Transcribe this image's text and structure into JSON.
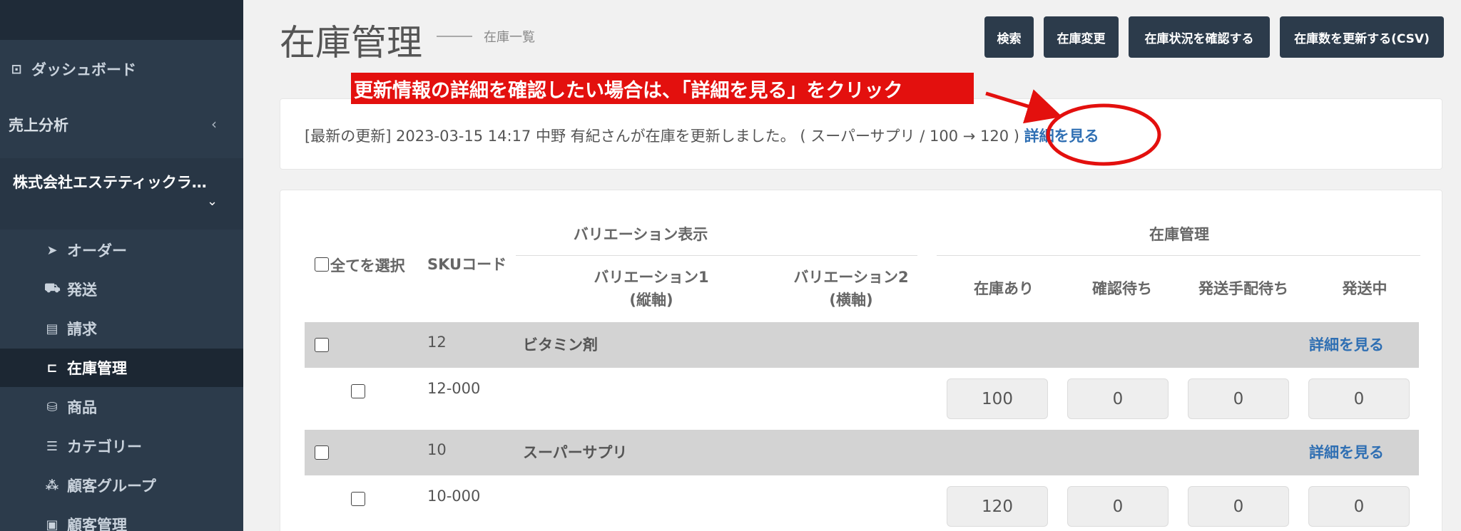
{
  "sidebar": {
    "dashboard": "ダッシュボード",
    "sales_analysis": "売上分析",
    "sales_chevron": "‹",
    "company_name": "株式会社エステティックラ…",
    "company_chevron": "⌄",
    "items": [
      {
        "label": "オーダー",
        "icon": "paper-plane-icon"
      },
      {
        "label": "発送",
        "icon": "truck-icon"
      },
      {
        "label": "請求",
        "icon": "document-icon"
      },
      {
        "label": "在庫管理",
        "icon": "laptop-icon"
      },
      {
        "label": "商品",
        "icon": "shopping-bag-icon"
      },
      {
        "label": "カテゴリー",
        "icon": "list-icon"
      },
      {
        "label": "顧客グループ",
        "icon": "sitemap-icon"
      },
      {
        "label": "顧客管理",
        "icon": "address-book-icon"
      }
    ]
  },
  "header": {
    "title": "在庫管理",
    "subtitle": "在庫一覧",
    "buttons": {
      "search": "検索",
      "change": "在庫変更",
      "check_status": "在庫状況を確認する",
      "update_csv": "在庫数を更新する(CSV)"
    }
  },
  "annotation": {
    "callout": "更新情報の詳細を確認したい場合は、「詳細を見る」をクリック"
  },
  "update_notice": {
    "text": "[最新の更新] 2023-03-15 14:17 中野 有紀さんが在庫を更新しました。 ( スーパーサプリ / 100 → 120 )",
    "link": "詳細を見る"
  },
  "table": {
    "headers": {
      "select_all": "全てを選択",
      "sku": "SKUコード",
      "variation_group": "バリエーション表示",
      "variation1": "バリエーション1",
      "variation1_axis": "(縦軸)",
      "variation2": "バリエーション2",
      "variation2_axis": "(横軸)",
      "stock_group": "在庫管理",
      "in_stock": "在庫あり",
      "awaiting_confirmation": "確認待ち",
      "awaiting_shipment": "発送手配待ち",
      "shipping": "発送中"
    },
    "products": [
      {
        "sku": "12",
        "name": "ビタミン剤",
        "link": "詳細を見る",
        "variant": {
          "sku": "12-000",
          "in_stock": "100",
          "awaiting_confirmation": "0",
          "awaiting_shipment": "0",
          "shipping": "0"
        }
      },
      {
        "sku": "10",
        "name": "スーパーサプリ",
        "link": "詳細を見る",
        "variant": {
          "sku": "10-000",
          "in_stock": "120",
          "awaiting_confirmation": "0",
          "awaiting_shipment": "0",
          "shipping": "0"
        }
      }
    ]
  },
  "colors": {
    "sidebar_bg": "#2c3b4b",
    "button_bg": "#2c3b4b",
    "link": "#2f6fb3",
    "annotation_red": "#e3100e"
  }
}
